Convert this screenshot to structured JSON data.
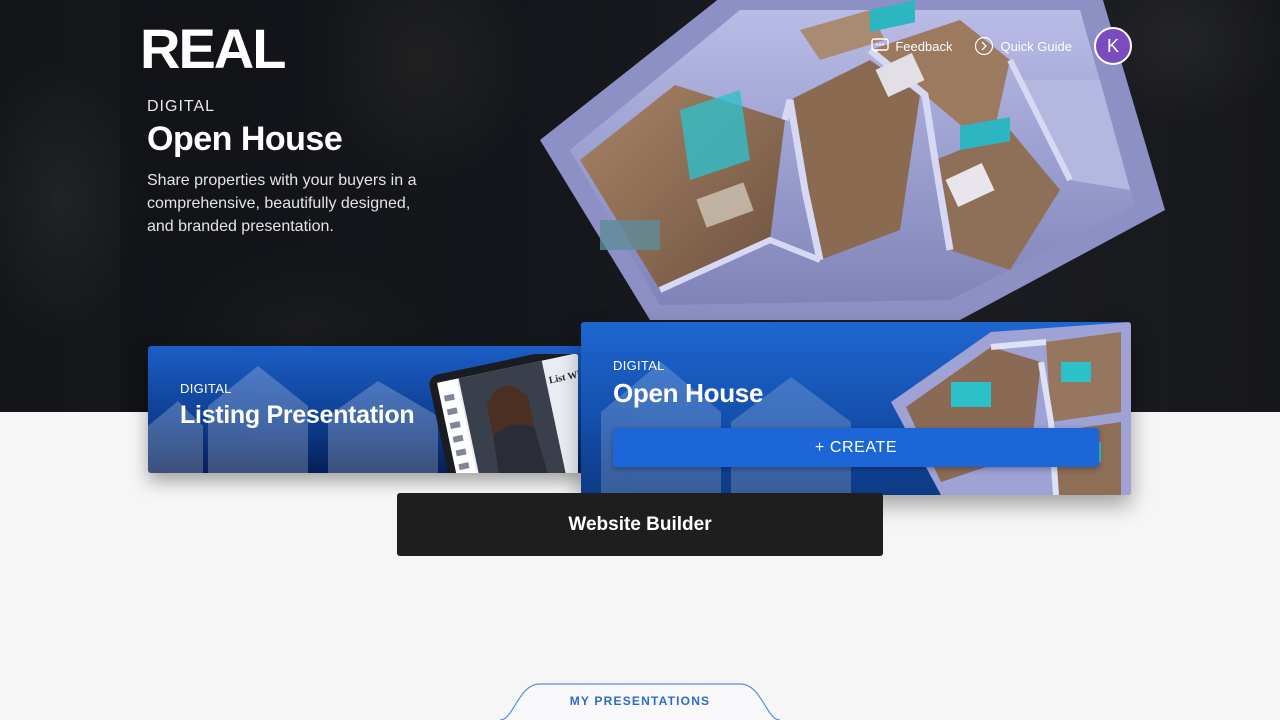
{
  "header": {
    "logo_text": "REAL",
    "feedback_label": "Feedback",
    "feedback_icon": "chat-bubble-icon",
    "quick_guide_label": "Quick Guide",
    "quick_guide_icon": "arrow-circle-icon",
    "avatar_initial": "K",
    "avatar_color": "#7b4bc0"
  },
  "hero": {
    "eyebrow": "DIGITAL",
    "title": "Open House",
    "description": "Share properties with your buyers in a comprehensive, beautifully designed, and branded presentation."
  },
  "cards": {
    "listing": {
      "eyebrow": "DIGITAL",
      "title": "Listing Presentation",
      "tablet_text": "List With Get Sol"
    },
    "open_house": {
      "eyebrow": "DIGITAL",
      "title": "Open House",
      "create_label": "+ CREATE"
    }
  },
  "website_builder_label": "Website Builder",
  "my_presentations_label": "MY PRESENTATIONS",
  "colors": {
    "accent_blue": "#1c66d8",
    "tab_blue": "#2c6cc4",
    "dark": "#1e1e1e"
  }
}
